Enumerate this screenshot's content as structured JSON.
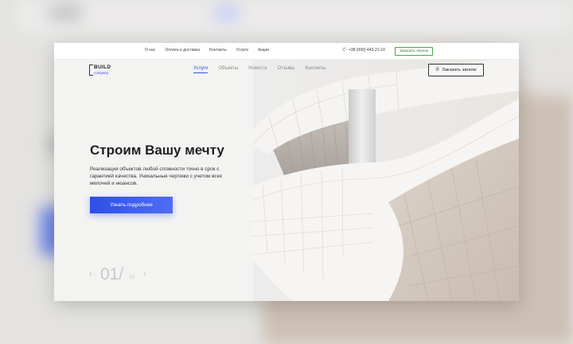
{
  "topbar": {
    "links": [
      "О нас",
      "Оплата и доставка",
      "Контакты",
      "Услуги",
      "Акции"
    ],
    "phone": "+38 (000) 443-21-10",
    "callback_label": "Заказать звонок"
  },
  "logo": {
    "primary": "BUILD",
    "secondary": "company"
  },
  "nav": {
    "items": [
      "Услуги",
      "Объекты",
      "Новости",
      "Отзывы",
      "Контакты"
    ],
    "active": "Услуги"
  },
  "callback_button": {
    "label": "Заказать звонок",
    "icon": "phone-icon"
  },
  "hero": {
    "title": "Строим Вашу мечту",
    "description": "Реализация объектов любой сложности точно в срок с гарантией качества. Уникальные чертежи с учетом всех мелочей и нюансов.",
    "cta_label": "Узнать подробнее"
  },
  "slider": {
    "current": "01/",
    "total": "03"
  },
  "colors": {
    "accent": "#2f56e2",
    "green": "#49a54a",
    "text": "#1f1f1f"
  }
}
